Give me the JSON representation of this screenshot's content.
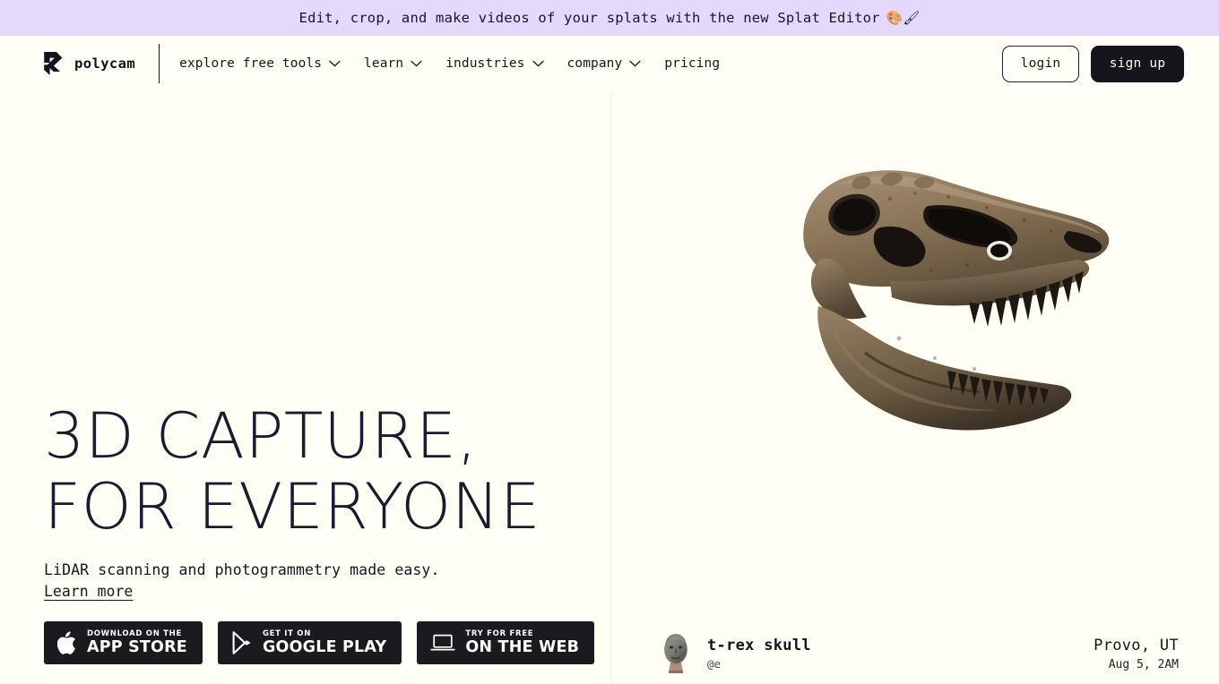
{
  "banner": {
    "text": "Edit, crop, and make videos of your splats with the new Splat Editor",
    "emoji": "🎨🖌",
    "background": "#E4D8FC"
  },
  "header": {
    "brand": "polycam",
    "logo_icon": "polycam-logo-icon",
    "nav": [
      {
        "label": "explore free tools",
        "has_dropdown": true
      },
      {
        "label": "learn",
        "has_dropdown": true
      },
      {
        "label": "industries",
        "has_dropdown": true
      },
      {
        "label": "company",
        "has_dropdown": true
      },
      {
        "label": "pricing",
        "has_dropdown": false
      }
    ],
    "login_label": "login",
    "signup_label": "sign up"
  },
  "hero": {
    "title": "3D CAPTURE,\nFOR EVERYONE",
    "subtitle": "LiDAR scanning and photogrammetry made easy.",
    "link_label": "Learn more",
    "badges": [
      {
        "small": "Download on the",
        "big": "App Store",
        "icon": "apple-icon"
      },
      {
        "small": "Get it on",
        "big": "Google Play",
        "icon": "google-play-icon"
      },
      {
        "small": "Try for free",
        "big": "On the Web",
        "icon": "laptop-icon"
      }
    ]
  },
  "showcase": {
    "image_alt": "t-rex-skull-3d-capture",
    "caption": {
      "avatar": "user-avatar-bust",
      "title": "t-rex skull",
      "username": "@e",
      "location": "Provo, UT",
      "timestamp": "Aug 5, 2AM"
    }
  },
  "colors": {
    "page_background": "#FEFEF5",
    "text": "#16161F",
    "heading": "#1B1B30",
    "banner": "#E4D8FC",
    "dark_button": "#15151C"
  }
}
